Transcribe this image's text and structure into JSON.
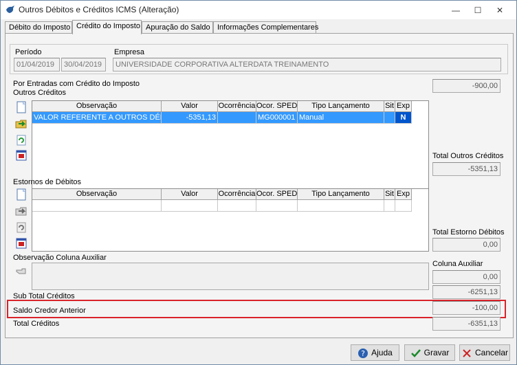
{
  "window": {
    "title": "Outros Débitos e Créditos ICMS (Alteração)",
    "minimize_glyph": "—",
    "maximize_glyph": "☐",
    "close_glyph": "✕"
  },
  "tabs": [
    {
      "label": "Débito do Imposto"
    },
    {
      "label": "Crédito do Imposto"
    },
    {
      "label": "Apuração do Saldo"
    },
    {
      "label": "Informações Complementares"
    }
  ],
  "header": {
    "periodo_label": "Período",
    "periodo_start": "01/04/2019",
    "periodo_end": "30/04/2019",
    "empresa_label": "Empresa",
    "empresa_value": "UNIVERSIDADE CORPORATIVA ALTERDATA TREINAMENTO"
  },
  "section_por_entradas": {
    "label": "Por Entradas com Crédito do Imposto",
    "value": "-900,00"
  },
  "outros_creditos": {
    "label": "Outros Créditos",
    "columns": [
      "Observação",
      "Valor",
      "Ocorrência",
      "Ocor. SPED",
      "Tipo Lançamento",
      "Sit",
      "Exp"
    ],
    "rows": [
      [
        "VALOR REFERENTE A OUTROS DÉB",
        "-5351,13",
        "",
        "MG000001",
        "Manual",
        "",
        "N"
      ]
    ],
    "total_label": "Total Outros Créditos",
    "total_value": "-5351,13"
  },
  "estornos": {
    "label": "Estornos de Débitos",
    "columns": [
      "Observação",
      "Valor",
      "Ocorrência",
      "Ocor. SPED",
      "Tipo Lançamento",
      "Sit",
      "Exp"
    ],
    "total_label": "Total Estorno Débitos",
    "total_value": "0,00"
  },
  "observacao": {
    "label": "Observação Coluna Auxiliar",
    "coluna_label": "Coluna Auxiliar",
    "coluna_value": "0,00"
  },
  "totals": {
    "sub_total_label": "Sub Total Créditos",
    "sub_total_value": "-6251,13",
    "saldo_label": "Saldo Credor Anterior",
    "saldo_value": "-100,00",
    "total_label": "Total Créditos",
    "total_value": "-6351,13"
  },
  "buttons": {
    "ajuda": "Ajuda",
    "gravar": "Gravar",
    "cancelar": "Cancelar"
  },
  "colors": {
    "highlight": "#d9222a",
    "selection": "#3399ff"
  }
}
